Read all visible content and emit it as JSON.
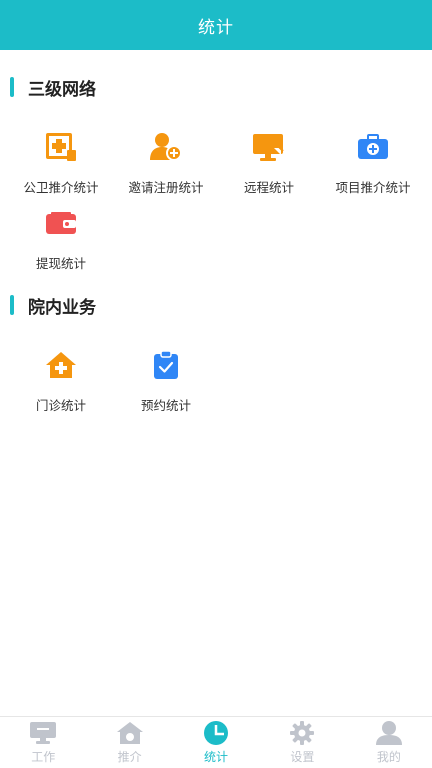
{
  "header": {
    "title": "统计"
  },
  "sections": [
    {
      "title": "三级网络",
      "items": [
        {
          "label": "公卫推介统计",
          "icon": "health-plus-icon"
        },
        {
          "label": "邀请注册统计",
          "icon": "user-add-icon"
        },
        {
          "label": "远程统计",
          "icon": "monitor-icon"
        },
        {
          "label": "项目推介统计",
          "icon": "medical-kit-icon"
        },
        {
          "label": "提现统计",
          "icon": "wallet-icon"
        }
      ]
    },
    {
      "title": "院内业务",
      "items": [
        {
          "label": "门诊统计",
          "icon": "clinic-house-icon"
        },
        {
          "label": "预约统计",
          "icon": "clipboard-check-icon"
        }
      ]
    }
  ],
  "tabbar": {
    "tabs": [
      {
        "label": "工作",
        "icon": "monitor-icon",
        "active": false
      },
      {
        "label": "推介",
        "icon": "home-icon",
        "active": false
      },
      {
        "label": "统计",
        "icon": "pie-chart-icon",
        "active": true
      },
      {
        "label": "设置",
        "icon": "gear-icon",
        "active": false
      },
      {
        "label": "我的",
        "icon": "person-icon",
        "active": false
      }
    ]
  },
  "colors": {
    "primary": "#1cbcc8",
    "orange": "#f5960f",
    "blue": "#2f86f6",
    "red": "#f05252",
    "tab_inactive": "#c0c4cc"
  }
}
